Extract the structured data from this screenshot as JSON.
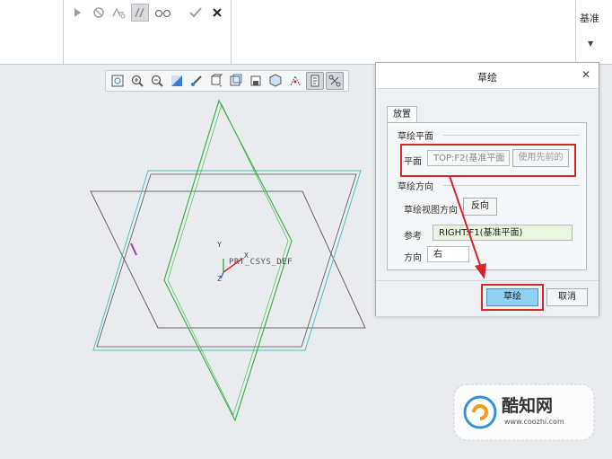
{
  "ribbon": {
    "datum_label": "基准"
  },
  "canvas": {
    "csys_label": "PRT_CSYS_DEF"
  },
  "dialog": {
    "title": "草绘",
    "tab_label": "放置",
    "sketch_plane_group": "草绘平面",
    "plane_label": "平面",
    "plane_value": "TOP:F2(基准平面",
    "use_previous_label": "使用先前的",
    "orientation_group": "草绘方向",
    "view_direction_label": "草绘视图方向",
    "flip_label": "反向",
    "reference_label": "参考",
    "reference_value": "RIGHT:F1(基准平面)",
    "direction_label": "方向",
    "direction_value": "右",
    "sketch_button": "草绘",
    "cancel_button": "取消"
  },
  "watermark": {
    "brand": "酷知网",
    "url": "www.coozhi.com"
  },
  "colors": {
    "highlight": "#d7262c",
    "primary_button": "#8fd0f3",
    "reference_field": "#e9f5df"
  }
}
